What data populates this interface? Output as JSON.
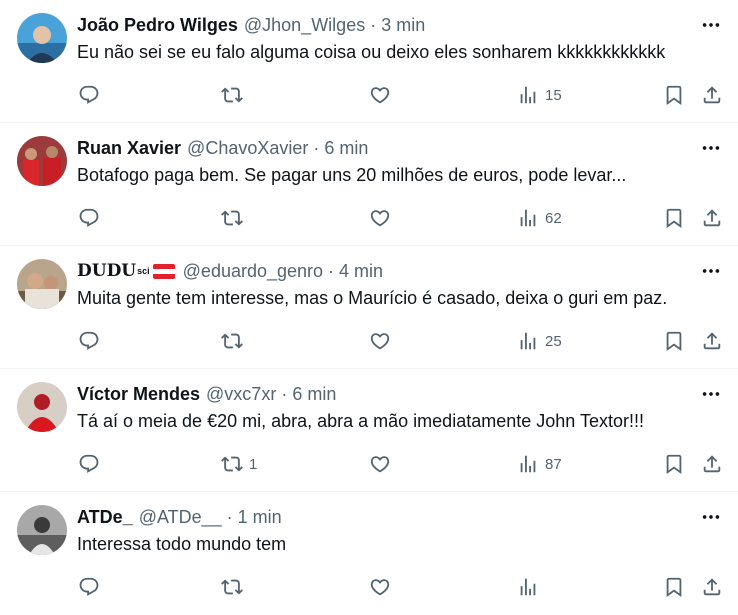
{
  "tweets": [
    {
      "name": "João Pedro Wilges",
      "handle": "@Jhon_Wilges",
      "separator": "·",
      "time": "3 min",
      "text": "Eu não sei se eu falo alguma coisa ou deixo eles sonharem kkkkkkkkkkkk",
      "replies": "",
      "retweets": "",
      "likes": "",
      "views": "15"
    },
    {
      "name": "Ruan Xavier",
      "handle": "@ChavoXavier",
      "separator": "·",
      "time": "6 min",
      "text": "Botafogo paga bem. Se pagar uns 20 milhões de euros, pode levar...",
      "replies": "",
      "retweets": "",
      "likes": "",
      "views": "62"
    },
    {
      "name": "DUDU",
      "name_sup": "sci",
      "flag": "austria-flag",
      "handle": "@eduardo_genro",
      "separator": "·",
      "time": "4 min",
      "text": "Muita gente tem interesse, mas o Maurício é casado, deixa o guri em paz.",
      "replies": "",
      "retweets": "",
      "likes": "",
      "views": "25"
    },
    {
      "name": "Víctor Mendes",
      "handle": "@vxc7xr",
      "separator": "·",
      "time": "6 min",
      "text": "Tá aí o meia de €20 mi, abra, abra a mão imediatamente John Textor!!!",
      "replies": "",
      "retweets": "1",
      "likes": "",
      "views": "87"
    },
    {
      "name": "ATDe_",
      "handle": "@ATDe__",
      "separator": "·",
      "time": "1 min",
      "text": "Interessa todo mundo tem",
      "replies": "",
      "retweets": "",
      "likes": "",
      "views": ""
    }
  ],
  "icons": {
    "more": "more-horizontal-icon",
    "reply": "reply-icon",
    "retweet": "retweet-icon",
    "like": "heart-icon",
    "views": "views-chart-icon",
    "bookmark": "bookmark-icon",
    "share": "share-icon"
  },
  "colors": {
    "text_primary": "#0f1419",
    "text_secondary": "#536471",
    "divider": "#eff3f4"
  }
}
